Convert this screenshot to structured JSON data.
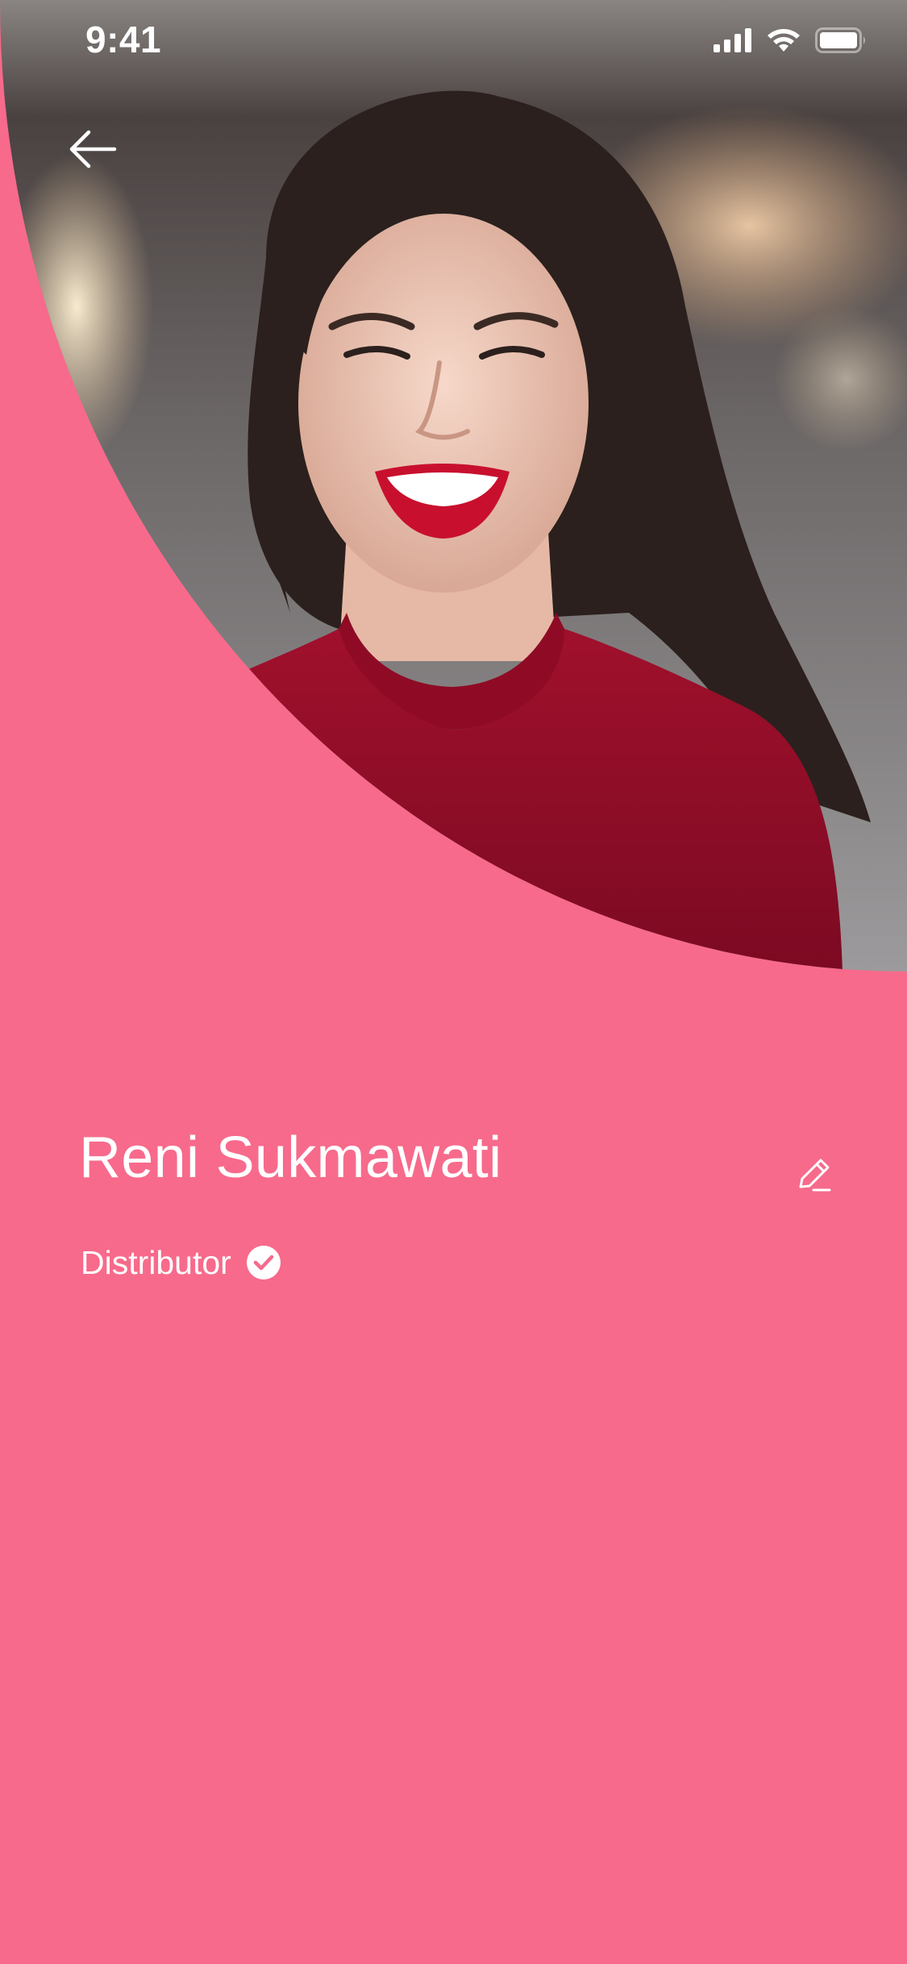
{
  "status_bar": {
    "time": "9:41",
    "icons": [
      "cellular-signal-icon",
      "wifi-icon",
      "battery-icon"
    ]
  },
  "navigation": {
    "back_icon": "arrow-left-icon"
  },
  "profile": {
    "name": "Reni Sukmawati",
    "role": "Distributor",
    "verified_icon": "check-circle-icon",
    "edit_icon": "pencil-icon"
  },
  "colors": {
    "accent": "#F76A8B",
    "text": "#FFFFFF"
  }
}
